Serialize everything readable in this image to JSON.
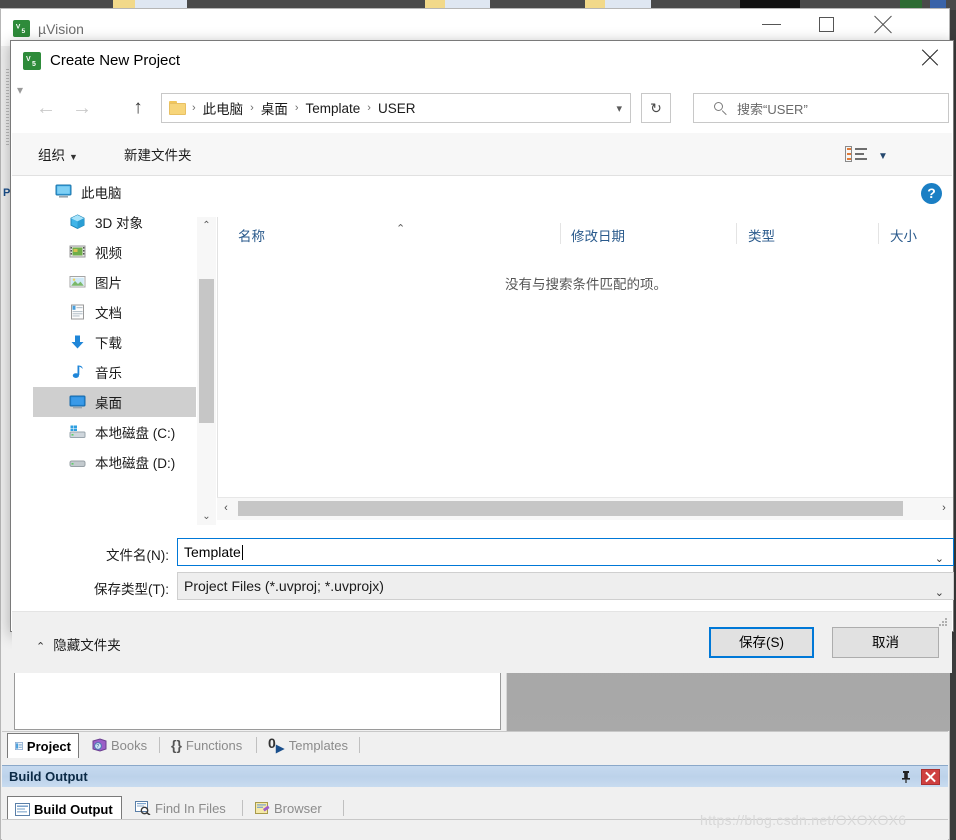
{
  "desktop": {
    "watermark": "https://blog.csdn.net/OXOXOX6"
  },
  "uvision": {
    "title": "µVision",
    "icon": "uvision-icon",
    "window_buttons": {
      "minimize": "—",
      "maximize": "□",
      "close": "✕"
    },
    "left_rail_label": "P",
    "project_tabs": [
      {
        "label": "Project",
        "icon": "project-icon",
        "active": true
      },
      {
        "label": "Books",
        "icon": "books-icon",
        "active": false
      },
      {
        "label": "Functions",
        "icon": "functions-icon",
        "active": false
      },
      {
        "label": "Templates",
        "icon": "templates-icon",
        "active": false
      }
    ],
    "build_output": {
      "caption": "Build Output",
      "pin_icon": "pin-icon",
      "close_icon": "close-icon",
      "tabs": [
        {
          "label": "Build Output",
          "icon": "build-output-icon",
          "active": true
        },
        {
          "label": "Find In Files",
          "icon": "find-in-files-icon",
          "active": false
        },
        {
          "label": "Browser",
          "icon": "browser-icon",
          "active": false
        }
      ]
    }
  },
  "dialog": {
    "title": "Create New Project",
    "icon": "uvision-icon",
    "close_icon": "close-icon",
    "nav": {
      "back_icon": "arrow-left-icon",
      "forward_icon": "arrow-right-icon",
      "recent_icon": "chevron-down-icon",
      "up_icon": "arrow-up-icon",
      "refresh_icon": "refresh-icon",
      "refresh_glyph": "↻",
      "breadcrumb_folder_icon": "folder-icon",
      "breadcrumbs": [
        "此电脑",
        "桌面",
        "Template",
        "USER"
      ],
      "breadcrumb_separator": "›",
      "breadcrumb_dropdown_icon": "chevron-down-icon"
    },
    "search": {
      "icon": "search-icon",
      "placeholder": "搜索“USER”",
      "value": ""
    },
    "commandbar": {
      "organize_label": "组织",
      "organize_caret": "▼",
      "new_folder_label": "新建文件夹",
      "view_icon": "view-layout-icon",
      "view_caret": "▼",
      "help_label": "?",
      "help_icon": "help-icon"
    },
    "sidebar": {
      "items": [
        {
          "label": "此电脑",
          "icon": "this-pc-icon",
          "selected": false,
          "indent": 0
        },
        {
          "label": "3D 对象",
          "icon": "3d-objects-icon",
          "selected": false,
          "indent": 1
        },
        {
          "label": "视频",
          "icon": "videos-icon",
          "selected": false,
          "indent": 1
        },
        {
          "label": "图片",
          "icon": "pictures-icon",
          "selected": false,
          "indent": 1
        },
        {
          "label": "文档",
          "icon": "documents-icon",
          "selected": false,
          "indent": 1
        },
        {
          "label": "下载",
          "icon": "downloads-icon",
          "selected": false,
          "indent": 1
        },
        {
          "label": "音乐",
          "icon": "music-icon",
          "selected": false,
          "indent": 1
        },
        {
          "label": "桌面",
          "icon": "desktop-icon",
          "selected": true,
          "indent": 1
        },
        {
          "label": "本地磁盘 (C:)",
          "icon": "local-disk-c-icon",
          "selected": false,
          "indent": 1
        },
        {
          "label": "本地磁盘 (D:)",
          "icon": "local-disk-d-icon",
          "selected": false,
          "indent": 1
        }
      ],
      "scroll": {
        "up_glyph": "⌃",
        "down_glyph": "⌄"
      }
    },
    "filelist": {
      "columns": [
        {
          "label": "名称",
          "sorted": true,
          "sort_glyph": "⌃"
        },
        {
          "label": "修改日期",
          "sorted": false
        },
        {
          "label": "类型",
          "sorted": false
        },
        {
          "label": "大小",
          "sorted": false
        }
      ],
      "rows": [],
      "empty_message": "没有与搜索条件匹配的项。",
      "hscroll": {
        "left_glyph": "‹",
        "right_glyph": "›"
      }
    },
    "form": {
      "filename_label": "文件名(N):",
      "filename_value": "Template",
      "savetype_label": "保存类型(T):",
      "savetype_value": "Project Files (*.uvproj; *.uvprojx)",
      "savetype_chevron": "⌄",
      "filename_chevron": "⌄"
    },
    "footer": {
      "hide_folders_label": "隐藏文件夹",
      "hide_folders_caret": "⌃",
      "save_label": "保存(S)",
      "cancel_label": "取消"
    }
  },
  "colors": {
    "accent_blue": "#0078d7",
    "column_header_blue": "#2a5a8c",
    "selection_gray": "#cfcfcf",
    "caption_blue": "#c5d9ef",
    "close_red": "#cf4040"
  }
}
